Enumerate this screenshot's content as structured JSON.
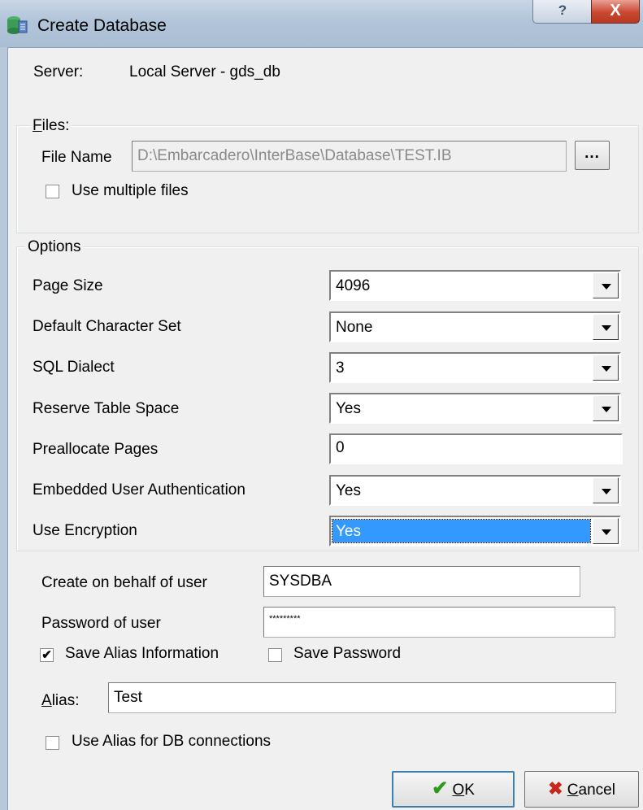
{
  "window": {
    "title": "Create Database",
    "help": "?",
    "close": "X"
  },
  "server": {
    "label": "Server:",
    "value": "Local Server - gds_db"
  },
  "files": {
    "legend_key": "F",
    "legend_rest": "iles:",
    "file_name_label": "File Name",
    "file_name_value": "D:\\Embarcadero\\InterBase\\Database\\TEST.IB",
    "browse": "...",
    "use_multiple_label": "Use multiple files",
    "use_multiple_checked": false
  },
  "options": {
    "legend": "Options",
    "rows": [
      {
        "label": "Page Size",
        "value": "4096"
      },
      {
        "label": "Default Character Set",
        "value": "None"
      },
      {
        "label": "SQL Dialect",
        "value": "3"
      },
      {
        "label": "Reserve Table Space",
        "value": "Yes"
      },
      {
        "label": "Preallocate Pages",
        "value": "0"
      },
      {
        "label": "Embedded User Authentication",
        "value": "Yes"
      },
      {
        "label": "Use Encryption",
        "value": "Yes"
      }
    ]
  },
  "user": {
    "behalf_label": "Create on behalf of user",
    "behalf_value": "SYSDBA",
    "password_label": "Password of user",
    "password_value": "*********"
  },
  "save_alias": {
    "label": "Save Alias Information",
    "checked": true,
    "check_mark": "✔"
  },
  "save_password": {
    "label": "Save Password",
    "checked": false
  },
  "alias": {
    "label_key": "A",
    "label_rest": "lias:",
    "value": "Test"
  },
  "use_alias": {
    "label": "Use Alias for DB connections",
    "checked": false
  },
  "buttons": {
    "ok_key": "O",
    "ok_rest": "K",
    "ok_icon": "✔",
    "cancel_key": "C",
    "cancel_rest": "ancel",
    "cancel_icon": "✖"
  },
  "colors": {
    "ok_icon": "#2e9a1a",
    "cancel_icon": "#c8281c",
    "selection": "#3399ff"
  }
}
